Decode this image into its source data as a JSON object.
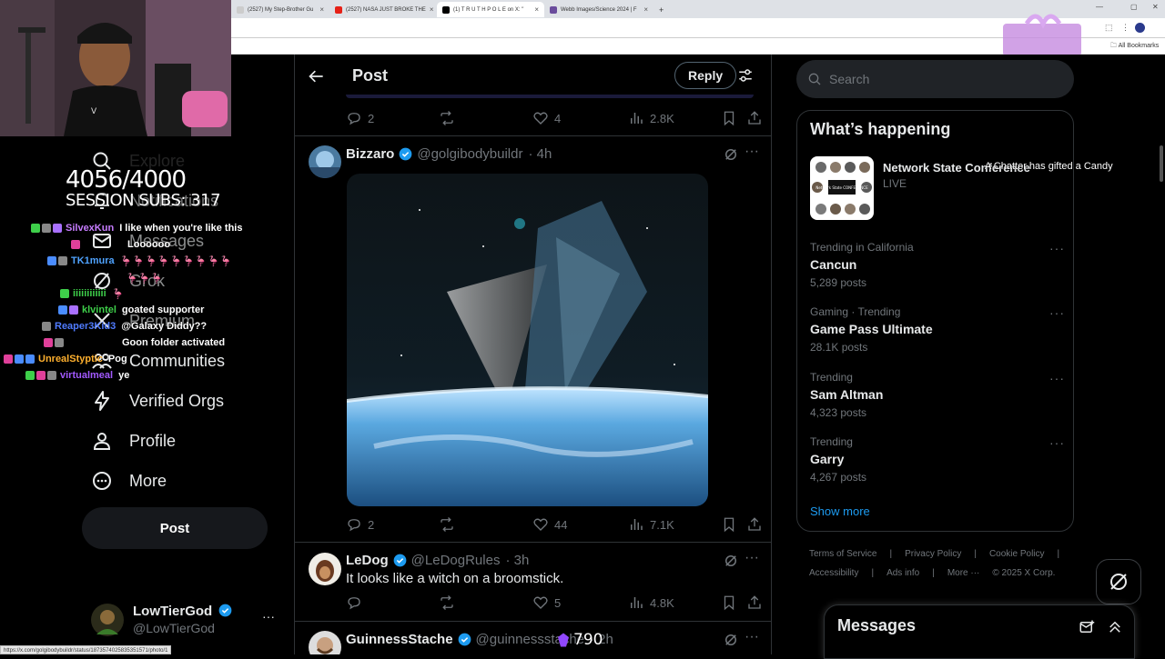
{
  "browser": {
    "tabs": [
      {
        "title": "(2527) My Step-Brother Gu"
      },
      {
        "title": "(2527) NASA JUST BROKE THE"
      },
      {
        "title": "(1) T R U T H P O L E on X: \""
      },
      {
        "title": "Webb Images/Science 2024 | F"
      }
    ],
    "new_tab": "+",
    "all_bookmarks": "All Bookmarks",
    "status_url": "https://x.com/golgibodybuildr/status/1873574025835351571/photo/1"
  },
  "overlay": {
    "subs_counter": "4056/4000",
    "session_subs": "SESSION SUBS: 317",
    "gift_notice": "A Chatter has gifted a Candy",
    "bits_count": "790",
    "chat": [
      {
        "user": "SilvexKun",
        "msg": "I like when you're like this",
        "color": "#c77dff"
      },
      {
        "user": "",
        "msg": "Loooooo",
        "color": "#ffffff"
      },
      {
        "user": "TK1mura",
        "msg": "🦩🦩🦩🦩🦩🦩🦩🦩🦩",
        "color": "#4fa3ff"
      },
      {
        "user": "",
        "msg": "🦩🦩🦩",
        "color": "#ffffff"
      },
      {
        "user": "iiiiiiiiiiii",
        "msg": "🦩",
        "color": "#3ecf4a"
      },
      {
        "user": "klvintel",
        "msg": "goated supporter",
        "color": "#3ecf4a"
      },
      {
        "user": "Reaper3Kid3",
        "msg": "@Galaxy Diddy??",
        "color": "#4f7bff"
      },
      {
        "user": "",
        "msg": "Goon folder activated",
        "color": "#1f3dff"
      },
      {
        "user": "UnrealStyptic",
        "msg": "Pog",
        "color": "#ffb02e"
      },
      {
        "user": "virtualmeal",
        "msg": "ye",
        "color": "#a259ff"
      }
    ]
  },
  "sidebar": {
    "items": [
      {
        "label": "Explore",
        "icon": "search-icon"
      },
      {
        "label": "Notifications",
        "icon": "bell-icon"
      },
      {
        "label": "Messages",
        "icon": "mail-icon"
      },
      {
        "label": "Grok",
        "icon": "grok-icon"
      },
      {
        "label": "Premium",
        "icon": "x-logo-icon"
      },
      {
        "label": "Communities",
        "icon": "people-icon"
      },
      {
        "label": "Verified Orgs",
        "icon": "lightning-icon"
      },
      {
        "label": "Profile",
        "icon": "person-icon"
      },
      {
        "label": "More",
        "icon": "more-circle-icon"
      }
    ],
    "post_button": "Post",
    "account": {
      "name": "LowTierGod",
      "handle": "@LowTierGod",
      "more": "···"
    }
  },
  "feed": {
    "header_title": "Post",
    "reply_label": "Reply",
    "top_actions": {
      "replies": "2",
      "likes": "4",
      "views": "2.8K"
    },
    "tweets": [
      {
        "name": "Bizzaro",
        "handle": "@golgibodybuildr",
        "time": "· 4h",
        "text": "",
        "replies": "2",
        "retweets": "",
        "likes": "44",
        "views": "7.1K"
      },
      {
        "name": "LeDog",
        "handle": "@LeDogRules",
        "time": "· 3h",
        "text": "It looks like a witch on a broomstick.",
        "replies": "",
        "retweets": "",
        "likes": "5",
        "views": "4.8K"
      },
      {
        "name": "GuinnessStache",
        "handle": "@guinnessstache",
        "time": "· 2h",
        "text": "",
        "replies": "",
        "retweets": "",
        "likes": "",
        "views": ""
      }
    ]
  },
  "right": {
    "search_placeholder": "Search",
    "whats_happening": "What’s happening",
    "live_event": {
      "title": "Network State Conference",
      "status": "LIVE",
      "thumb_label": "Network State CONFERENCE"
    },
    "trends": [
      {
        "context": "Trending in California",
        "title": "Cancun",
        "count": "5,289 posts"
      },
      {
        "context": "Gaming · Trending",
        "title": "Game Pass Ultimate",
        "count": "28.1K posts"
      },
      {
        "context": "Trending",
        "title": "Sam Altman",
        "count": "4,323 posts"
      },
      {
        "context": "Trending",
        "title": "Garry",
        "count": "4,267 posts"
      }
    ],
    "show_more": "Show more",
    "footer": {
      "row1": [
        "Terms of Service",
        "|",
        "Privacy Policy",
        "|",
        "Cookie Policy",
        "|"
      ],
      "row2": [
        "Accessibility",
        "|",
        "Ads info",
        "|",
        "More ···",
        "© 2025 X Corp."
      ]
    },
    "messages_title": "Messages"
  },
  "colors": {
    "accent": "#1d9bf0",
    "verified": "#1d9bf0",
    "muted": "#71767b",
    "border": "#2f3336"
  }
}
